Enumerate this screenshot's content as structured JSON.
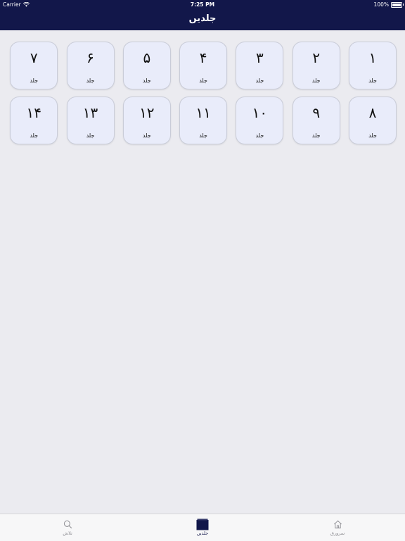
{
  "status_bar": {
    "carrier": "Carrier",
    "time": "7:25 PM",
    "battery": "100%",
    "battery_level": 1.0
  },
  "nav": {
    "title": "جلدیں"
  },
  "volumes": [
    {
      "number": "۱",
      "label": "جلد"
    },
    {
      "number": "۲",
      "label": "جلد"
    },
    {
      "number": "۳",
      "label": "جلد"
    },
    {
      "number": "۴",
      "label": "جلد"
    },
    {
      "number": "۵",
      "label": "جلد"
    },
    {
      "number": "۶",
      "label": "جلد"
    },
    {
      "number": "۷",
      "label": "جلد"
    },
    {
      "number": "۸",
      "label": "جلد"
    },
    {
      "number": "۹",
      "label": "جلد"
    },
    {
      "number": "۱۰",
      "label": "جلد"
    },
    {
      "number": "۱۱",
      "label": "جلد"
    },
    {
      "number": "۱۲",
      "label": "جلد"
    },
    {
      "number": "۱۳",
      "label": "جلد"
    },
    {
      "number": "۱۴",
      "label": "جلد"
    }
  ],
  "tabs": [
    {
      "label": "تلاش",
      "icon": "search-icon"
    },
    {
      "label": "جلدیں",
      "icon": "book-icon"
    },
    {
      "label": "سرورق",
      "icon": "home-icon"
    }
  ],
  "colors": {
    "nav_background": "#12174a",
    "page_background": "#ebebf0",
    "tile_background": "#e9ecfa",
    "tab_active": "#12174a",
    "tab_inactive": "#8e8e93"
  }
}
